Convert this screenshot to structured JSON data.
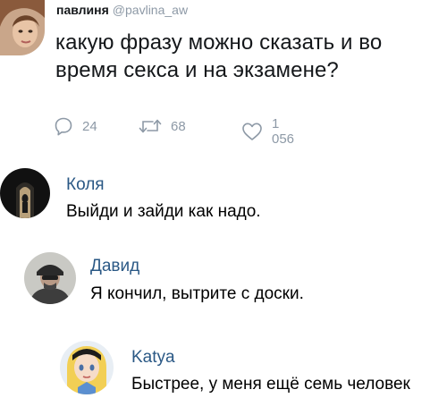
{
  "tweet": {
    "author_name": "павлиня",
    "author_handle": "@pavlina_aw",
    "text": "какую фразу можно сказать и во время секса и на экзамене?",
    "replies_count": "24",
    "retweets_count": "68",
    "likes_count": "1 056",
    "icons": [
      "reply-icon",
      "retweet-icon",
      "like-icon"
    ]
  },
  "comments": [
    {
      "name": "Коля",
      "text": "Выйди и зайди как надо."
    },
    {
      "name": "Давид",
      "text": "Я кончил, вытрите с доски."
    },
    {
      "name": "Katya",
      "text": "Быстрее, у меня ещё семь человек"
    }
  ],
  "colors": {
    "tweet_text": "#14171a",
    "handle": "#8d99a6",
    "comment_name": "#2a5885",
    "comment_text": "#000000"
  }
}
